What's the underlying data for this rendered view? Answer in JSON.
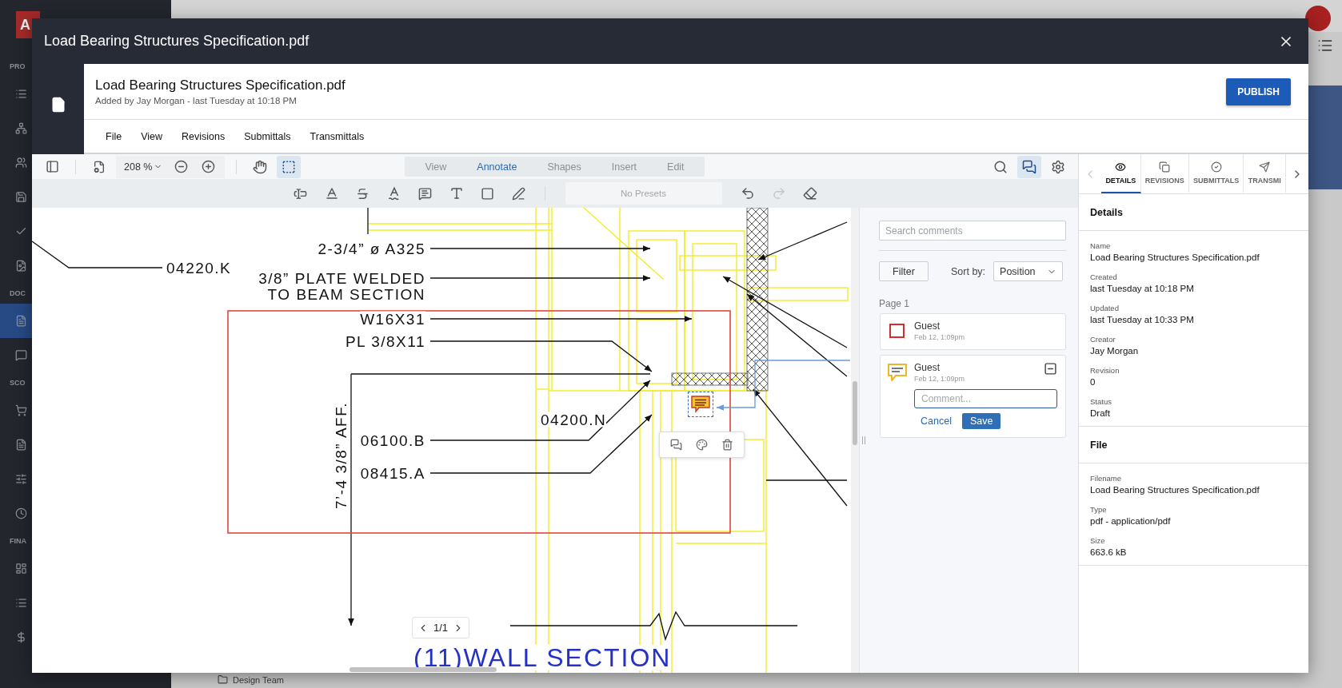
{
  "background_app": {
    "logo": "A",
    "sidebar_sections": [
      "PRO",
      "DOC",
      "SCO",
      "FINA"
    ],
    "folder_item": "Design Team"
  },
  "modal": {
    "title": "Load Bearing Structures Specification.pdf"
  },
  "document_header": {
    "title": "Load Bearing Structures Specification.pdf",
    "subtitle": "Added by Jay Morgan - last Tuesday at 10:18 PM",
    "publish_button": "PUBLISH"
  },
  "menu": [
    "File",
    "View",
    "Revisions",
    "Submittals",
    "Transmittals"
  ],
  "toolbar": {
    "zoom": "208 %",
    "view_tools": [
      {
        "kind": "pan",
        "selected": false
      },
      {
        "kind": "marquee",
        "selected": true
      }
    ],
    "modes": [
      {
        "label": "View",
        "selected": false
      },
      {
        "label": "Annotate",
        "selected": true
      },
      {
        "label": "Shapes",
        "selected": false
      },
      {
        "label": "Insert",
        "selected": false
      },
      {
        "label": "Edit",
        "selected": false
      }
    ],
    "panel_toggles": [
      {
        "kind": "search",
        "selected": false
      },
      {
        "kind": "comments",
        "selected": true
      },
      {
        "kind": "settings",
        "selected": false
      }
    ],
    "presets_placeholder": "No Presets",
    "redo_disabled": true
  },
  "drawing": {
    "labels": [
      "04220.K",
      "2-3/4” ø A325",
      "3/8” PLATE WELDED",
      "TO BEAM SECTION",
      "W16X31",
      "PL 3/8X11",
      "04200.N",
      "06100.B",
      "08415.A"
    ],
    "dimension": "7’-4 3/8” AFF.",
    "title": "(11)WALL SECTION"
  },
  "page_indicator": "1/1",
  "comments": {
    "search_placeholder": "Search comments",
    "filter_button": "Filter",
    "sort_label": "Sort by:",
    "sort_value": "Position",
    "page_heading": "Page 1",
    "items": [
      {
        "kind": "rectangle",
        "author": "Guest",
        "time": "Feb 12, 1:09pm",
        "color": "#d0302b",
        "editing": false
      },
      {
        "kind": "note",
        "author": "Guest",
        "time": "Feb 12, 1:09pm",
        "color": "#f0b429",
        "editing": true
      }
    ],
    "comment_placeholder": "Comment...",
    "cancel_button": "Cancel",
    "save_button": "Save"
  },
  "details_panel": {
    "tabs": [
      {
        "label": "DETAILS",
        "kind": "eye",
        "selected": true
      },
      {
        "label": "REVISIONS",
        "kind": "copies",
        "selected": false
      },
      {
        "label": "SUBMITTALS",
        "kind": "check",
        "selected": false
      },
      {
        "label": "TRANSMI",
        "kind": "send",
        "selected": false
      }
    ],
    "sections": [
      {
        "title": "Details",
        "fields": [
          {
            "label": "Name",
            "value": "Load Bearing Structures Specification.pdf"
          },
          {
            "label": "Created",
            "value": "last Tuesday at 10:18 PM"
          },
          {
            "label": "Updated",
            "value": "last Tuesday at 10:33 PM"
          },
          {
            "label": "Creator",
            "value": "Jay Morgan"
          },
          {
            "label": "Revision",
            "value": "0"
          },
          {
            "label": "Status",
            "value": "Draft"
          }
        ]
      },
      {
        "title": "File",
        "fields": [
          {
            "label": "Filename",
            "value": "Load Bearing Structures Specification.pdf"
          },
          {
            "label": "Type",
            "value": "pdf - application/pdf"
          },
          {
            "label": "Size",
            "value": "663.6 kB"
          }
        ]
      }
    ]
  }
}
